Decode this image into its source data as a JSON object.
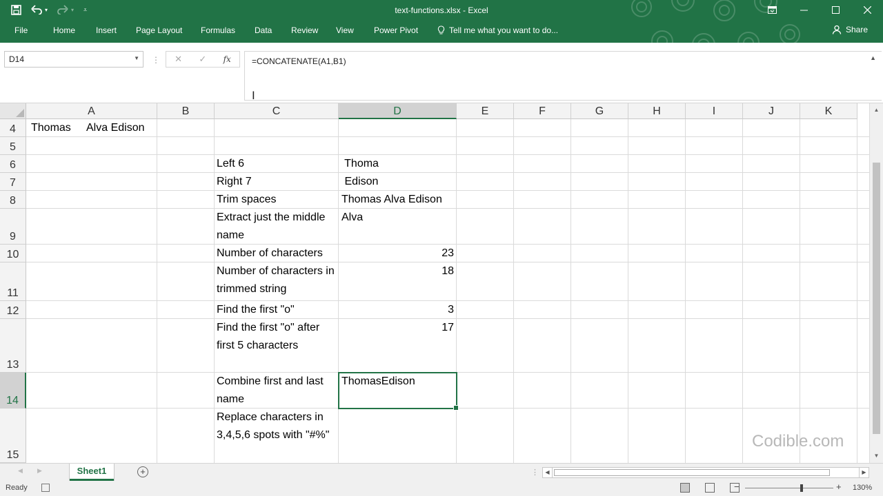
{
  "window": {
    "title": "text-functions.xlsx - Excel",
    "controls": [
      "restore-ribbon",
      "minimize",
      "maximize",
      "close"
    ]
  },
  "quick_access": {
    "save_icon": "save-icon",
    "undo_icon": "undo-icon",
    "redo_icon": "redo-icon",
    "customize_icon": "customize-qat-icon"
  },
  "ribbon": {
    "tabs": [
      "File",
      "Home",
      "Insert",
      "Page Layout",
      "Formulas",
      "Data",
      "Review",
      "View",
      "Power Pivot"
    ],
    "tell_me": "Tell me what you want to do...",
    "share": "Share"
  },
  "formula_bar": {
    "name_box": "D14",
    "formula": "=CONCATENATE(A1,B1)",
    "fx_label": "fx"
  },
  "columns": [
    "A",
    "B",
    "C",
    "D",
    "E",
    "F",
    "G",
    "H",
    "I",
    "J",
    "K"
  ],
  "selected_column": "D",
  "rows": [
    {
      "num": "4"
    },
    {
      "num": "5"
    },
    {
      "num": "6"
    },
    {
      "num": "7"
    },
    {
      "num": "8"
    },
    {
      "num": "9"
    },
    {
      "num": "10"
    },
    {
      "num": "11"
    },
    {
      "num": "12"
    },
    {
      "num": "13"
    },
    {
      "num": "14"
    },
    {
      "num": "15"
    }
  ],
  "selected_row": "14",
  "cells": {
    "A4": "Thomas",
    "A4b": "Alva Edison",
    "C6": "Left 6",
    "D6": " Thoma",
    "C7": "Right 7",
    "D7": " Edison",
    "C8": "Trim spaces",
    "D8": "Thomas Alva Edison",
    "C9": "Extract just the middle name",
    "D9": "Alva",
    "C10": "Number of characters",
    "D10": "23",
    "C11": "Number of characters in trimmed string",
    "D11": "18",
    "C12": "Find the first \"o\"",
    "D12": "3",
    "C13": "Find the first \"o\" after first 5 characters",
    "D13": "17",
    "C14": "Combine first and last name",
    "D14": "ThomasEdison",
    "C15": "Replace characters in 3,4,5,6 spots with \"#%\""
  },
  "sheets": [
    "Sheet1"
  ],
  "active_sheet": "Sheet1",
  "status": {
    "ready": "Ready",
    "zoom": "130%"
  },
  "watermark": "Codible.com",
  "colors": {
    "excel_green": "#217346",
    "header_bg": "#f3f3f3",
    "selected_header_bg": "#d2d2d2",
    "gridline": "#dadada"
  }
}
